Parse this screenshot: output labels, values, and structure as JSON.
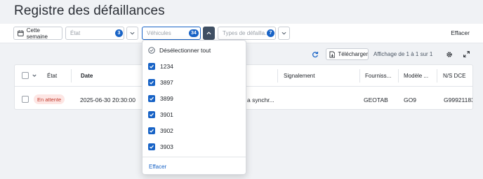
{
  "page": {
    "title": "Registre des défaillances"
  },
  "filters": {
    "week_label": "Cette semaine",
    "status": {
      "placeholder": "État",
      "count": "3"
    },
    "vehicles": {
      "placeholder": "Véhicules",
      "count": "34"
    },
    "fault_types": {
      "placeholder": "Types de défailla...",
      "count": "7"
    },
    "clear_label": "Effacer"
  },
  "toolbar": {
    "download_label": "Télécharger",
    "pagination": "Affichage de 1 à 1 sur 1"
  },
  "table": {
    "columns": [
      "État",
      "Date",
      "Signalement",
      "Fourniss...",
      "Modèle ...",
      "N/S DCE"
    ],
    "rows": [
      {
        "status": "En attente",
        "date": "2025-06-30 20:30:00",
        "fault_snippet": "a synchr...",
        "signalement": "",
        "provider": "GEOTAB",
        "model": "GO9",
        "serial": "G99921183"
      }
    ]
  },
  "vehicle_dropdown": {
    "deselect_all": "Désélectionner tout",
    "items": [
      "1234",
      "3897",
      "3899",
      "3901",
      "3902",
      "3903"
    ],
    "clear_label": "Effacer"
  },
  "colors": {
    "accent": "#1863c6",
    "pending_bg": "#fde6e4",
    "pending_fg": "#c23b2e",
    "dark_toggle": "#3f4f63"
  }
}
